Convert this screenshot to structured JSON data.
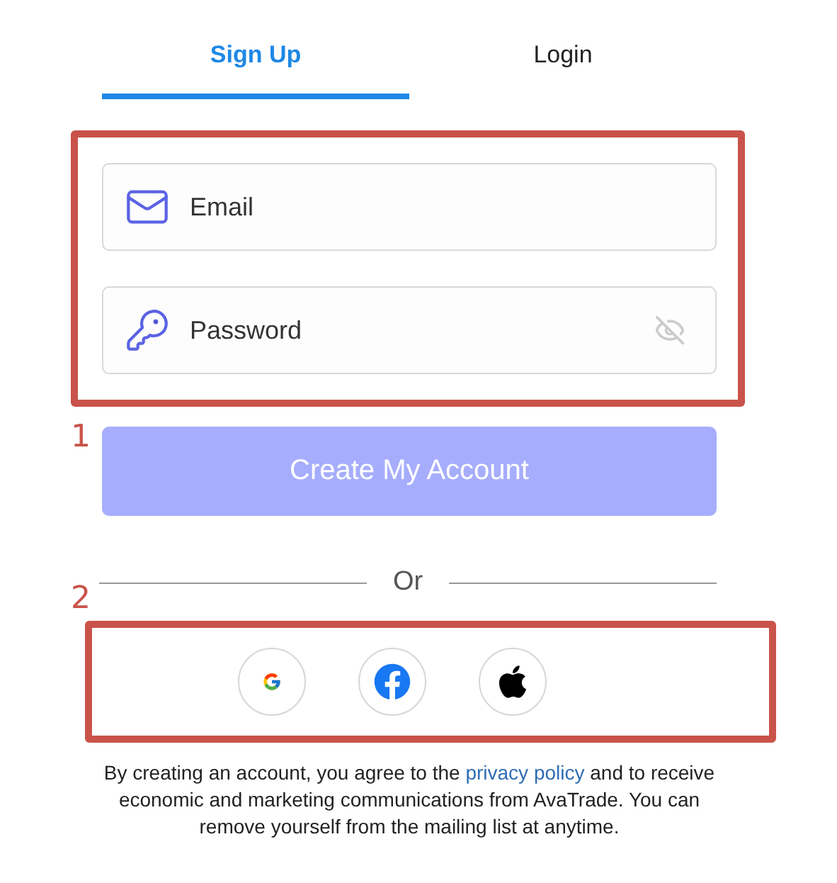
{
  "tabs": [
    {
      "label": "Sign Up",
      "selected": true
    },
    {
      "label": "Login",
      "selected": false
    }
  ],
  "annotations": [
    {
      "label": "1"
    },
    {
      "label": "2"
    }
  ],
  "fields": [
    {
      "kind": "email",
      "placeholder": "Email"
    },
    {
      "kind": "password",
      "placeholder": "Password"
    }
  ],
  "submit_button": {
    "label": "Create My Account",
    "disabled": true
  },
  "divider": {
    "label": "Or"
  },
  "social_buttons": [
    {
      "kind": "google"
    },
    {
      "kind": "facebook"
    },
    {
      "kind": "apple"
    }
  ],
  "terms": {
    "before": "By creating an account, you agree to the ",
    "link": "privacy policy",
    "after": " and to receive economic and marketing communications from AvaTrade. You can remove yourself from the mailing list at anytime."
  }
}
